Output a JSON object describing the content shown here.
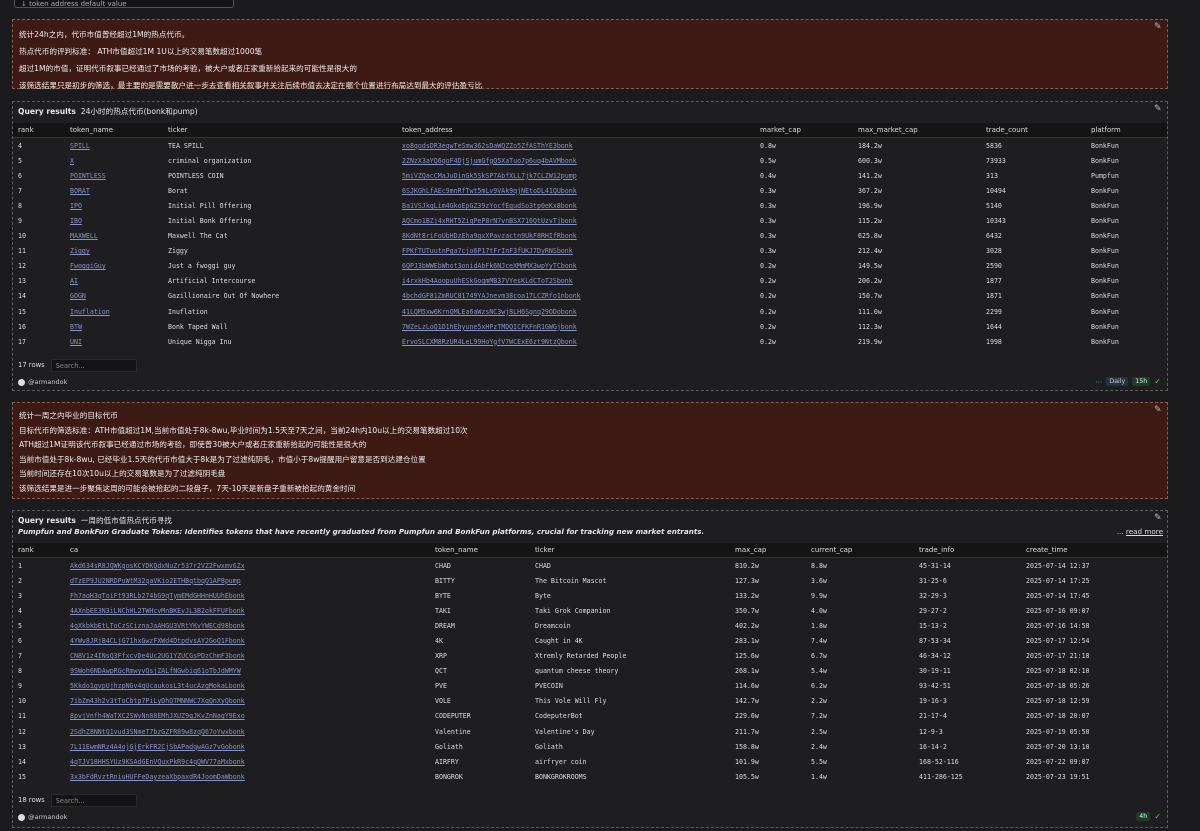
{
  "top_input": {
    "placeholder": "↓ token address  default value"
  },
  "note1": {
    "lines": [
      "统计24h之内，代币市值曾经超过1M的热点代币。",
      "热点代币的评判标准：  ATH市值超过1M 1U以上的交易笔数超过1000笔",
      "超过1M的市值，证明代币叙事已经通过了市场的考验，被大户或者庄家重新拾起来的可能性是很大的",
      "该筛选结果只是初步的筛选，最主要的是需要散户进一步去查看相关叙事并关注后续市值去决定在哪个位置进行布局达到最大的评估盈亏比"
    ]
  },
  "panel1": {
    "title_prefix": "Query results",
    "title": "24小时的热点代币(bonk和pump)",
    "columns": [
      "rank",
      "token_name",
      "ticker",
      "token_address",
      "market_cap",
      "max_market_cap",
      "trade_count",
      "platform"
    ],
    "rows": [
      [
        "4",
        "SPILL",
        "TEA SPILL",
        "xo8qodsDR3eqwTeSmw362sDaWQZZo5ZfASThYE3bonk",
        "0.8w",
        "184.2w",
        "5836",
        "BonkFun"
      ],
      [
        "5",
        "X",
        "criminal organization",
        "2ZNzX3aYQ6qoF4DjSjumGfgQ5XaTuo7p6uq4bAVMbonk",
        "0.5w",
        "600.3w",
        "73933",
        "BonkFun"
      ],
      [
        "6",
        "POINTLESS",
        "POINTLESS COIN",
        "5miVZQacCMaJuDinGk5SkSP7AbfXLL7jk7CLZW12pump",
        "0.4w",
        "141.2w",
        "313",
        "Pumpfun"
      ],
      [
        "7",
        "BORAT",
        "Borat",
        "6SJKGhLfAEc9mnRfTwt5mLv9VAk9qjNEtoDL41QUbonk",
        "0.3w",
        "367.2w",
        "10494",
        "BonkFun"
      ],
      [
        "8",
        "IPO",
        "Initial Pill Offering",
        "Ba1VSJkqLim4GkoEpGZ39zYocfEgudSo3tp0eKx8bonk",
        "0.3w",
        "196.9w",
        "5140",
        "BonkFun"
      ],
      [
        "9",
        "IBO",
        "Initial Bonk Offering",
        "AQCmo1BZj4xRHT5ZiqPeP8rN7vnBSX716QtUzvTjbonk",
        "0.3w",
        "115.2w",
        "10343",
        "BonkFun"
      ],
      [
        "10",
        "MAXWELL",
        "Maxwell The Cat",
        "8KdNt8riFoUbHDzEha9gxXPavzactn9UkF8RHIfRbonk",
        "0.3w",
        "625.8w",
        "6432",
        "BonkFun"
      ],
      [
        "11",
        "Ziggy",
        "Ziggy",
        "FPKfTUTuutnPga7cjo6P17tFrInF3fUKJ7DyRNSbonk",
        "0.3w",
        "212.4w",
        "3028",
        "BonkFun"
      ],
      [
        "12",
        "FwoggiGuy",
        "Just a fwoggi guy",
        "6QPJ3bWWEbWhot3onidAbFk6NJceXMmMX3wpYyTCbonk",
        "0.2w",
        "149.5w",
        "2590",
        "BonkFun"
      ],
      [
        "13",
        "AI",
        "Artificial Intercourse",
        "i4rxkHb4AoopuUhESkGogmMB37VYesKLdCToT2Sbonk",
        "0.2w",
        "206.2w",
        "1877",
        "BonkFun"
      ],
      [
        "14",
        "GOGN",
        "Gazillionaire Out Of Nowhere",
        "4bchdGF81ZmRUC81749YAJnevm38coa17LCZRfo1nbonk",
        "0.2w",
        "150.7w",
        "1871",
        "BonkFun"
      ],
      [
        "15",
        "Inuflation",
        "Inuflation",
        "41LQM5xw6KrnQMLEa6aWzsNC3wj8LH6Sgnq29ODobonk",
        "0.2w",
        "111.0w",
        "2299",
        "BonkFun"
      ],
      [
        "16",
        "BTW",
        "Bonk Taped Wall",
        "7WZeLzLoQ1D1hEhyune5xHPzTMDQICFKFnR1GWGjbonk",
        "0.2w",
        "112.3w",
        "1644",
        "BonkFun"
      ],
      [
        "17",
        "UNI",
        "Unique Nigga Inu",
        "ErvoSLCXM8RzUR4LeL99HoYgfV7WCExE6zt9NtzQbonk",
        "0.2w",
        "219.9w",
        "1998",
        "BonkFun"
      ]
    ],
    "rows_label": "17 rows",
    "search_placeholder": "Search...",
    "author": "@armandok",
    "badge_daily": "Daily",
    "badge_time": "15h"
  },
  "note2": {
    "lines": [
      "统计一周之内毕业的目标代币",
      "目标代币的筛选标准：ATH市值超过1M,当前市值处于8k-8wu,毕业时间为1.5天至7天之间，当前24h内10u以上的交易笔数超过10次",
      "ATH超过1M证明该代币叙事已经通过市场的考验，即使曾30被大户或者庄家重新拾起的可能性是很大的",
      "当前市值处于8k-8wu, 已经毕业1.5天的代币市值大于8k是为了过滤纯阴毛，市值小于8w提醒用户留意是否到达建仓位置",
      "当前时间还存在10次10u以上的交易笔数是为了过滤纯阴毛盘",
      "该筛选结果是进一步聚焦这周的可能会被拾起的二段盘子，7天-10天是新盘子重新被拾起的黄金时间"
    ]
  },
  "panel2": {
    "title_prefix": "Query results",
    "title": "一周的低市值热点代币寻找",
    "subtitle": "Pumpfun and BonkFun Graduate Tokens: Identifies tokens that have recently graduated from Pumpfun and BonkFun platforms, crucial for tracking new market entrants.",
    "read_more_prefix": "...",
    "read_more": "read more",
    "columns": [
      "rank",
      "ca",
      "token_name",
      "ticker",
      "max_cap",
      "current_cap",
      "trade_info",
      "create_time"
    ],
    "rows": [
      [
        "1",
        "Akd634sR8JQWKgosKCYDKQdxNuZr537r2VZ2Fwxmv6Zx",
        "CHAD",
        "CHAD",
        "810.2w",
        "8.8w",
        "45-31-14",
        "2025-07-14 12:37"
      ],
      [
        "2",
        "dTzEP9JU2NRDPuWtM32qaVKio2ETHBqtbqQ1AP8pump",
        "BITTY",
        "The Bitcoin Mascot",
        "127.3w",
        "3.6w",
        "31-25-6",
        "2025-07-14 17:25"
      ],
      [
        "3",
        "Fh7aoH3qToiFt93RLb274bG9qTymEMdGHHnHUUhEbonk",
        "BYTE",
        "Byte",
        "133.2w",
        "9.9w",
        "32-29-3",
        "2025-07-14 17:45"
      ],
      [
        "4",
        "4AXnbEE3N3iLNChHL2TWHcvMnBKEvJL3B2okFFUFbonk",
        "TAKI",
        "Taki Grok Companion",
        "350.7w",
        "4.0w",
        "29-27-2",
        "2025-07-16 09:07"
      ],
      [
        "5",
        "4qXkbkbEtLToCzSCiznaJaAHGU3VRtYKvYWECd98bonk",
        "DREAM",
        "Dreamcoin",
        "402.2w",
        "1.8w",
        "15-13-2",
        "2025-07-16 14:58"
      ],
      [
        "6",
        "4YWv8JRjB4CLjG71hxGwzFXWd4DtpdvsAY2GoQ1Fbonk",
        "4K",
        "Caught in 4K",
        "283.1w",
        "7.4w",
        "87-53-34",
        "2025-07-17 12:54"
      ],
      [
        "7",
        "CN8V1z4INsQ3FfxcvDe4Uc2UG1YZUCGsPDzChmF3bonk",
        "XRP",
        "Xtremly Retarded People",
        "125.6w",
        "6.7w",
        "46-34-12",
        "2025-07-17 21:18"
      ],
      [
        "8",
        "9SWoh6NDAwpRGcRmwyvQsjZALfNGwbiq61oTbJdWMYW",
        "QCT",
        "quantum cheese theory",
        "268.1w",
        "5.4w",
        "30-19-11",
        "2025-07-18 02:10"
      ],
      [
        "9",
        "5Kkdo1gvpUjhzpNGv4qUcaukosL3t4ucAzgMokaLbonk",
        "PVE",
        "PVECOIN",
        "114.6w",
        "6.2w",
        "93-42-51",
        "2025-07-18 05:26"
      ],
      [
        "10",
        "7ibZm43h2v3tToCbtp7PiLyDhQTMNNWC7XqQnXyQbonk",
        "VOLE",
        "This Vole Will Fly",
        "142.7w",
        "2.2w",
        "19-16-3",
        "2025-07-18 12:59"
      ],
      [
        "11",
        "8pvjVnfh4WaTXC2SWvNn88EMhJXUZ9gJKvZnNagY9Exo",
        "CODEPUTER",
        "CodeputerBot",
        "229.6w",
        "7.2w",
        "21-17-4",
        "2025-07-18 20:07"
      ],
      [
        "12",
        "2SdhZ8NNtQ1vud3SNmeT7bzGZFR89w8zqQ67oYwxbonk",
        "Valentine",
        "Valentine's Day",
        "211.7w",
        "2.5w",
        "12-9-3",
        "2025-07-19 05:50"
      ],
      [
        "13",
        "7L11EwmNRz4A4ojGjErkFR2CjSbAPadqwAGz7vGobonk",
        "Goliath",
        "Goliath",
        "158.8w",
        "2.4w",
        "16-14-2",
        "2025-07-20 13:10"
      ],
      [
        "14",
        "4qTJV18HHSYUz9KSAdGEnVQuxPkR9c4qQWV77aMxbonk",
        "AIRFRY",
        "airfryer coin",
        "101.9w",
        "5.5w",
        "168-52-116",
        "2025-07-22 09:07"
      ],
      [
        "15",
        "3x3bFdRvztRniuHUFFeDayzeaXbpaxdR4JoomDaWbonk",
        "BONGROK",
        "BONKGROKROOMS",
        "105.5w",
        "1.4w",
        "411-286-125",
        "2025-07-23 19:51"
      ]
    ],
    "rows_label": "18 rows",
    "search_placeholder": "Search...",
    "author": "@armandok",
    "badge_time": "4h"
  }
}
